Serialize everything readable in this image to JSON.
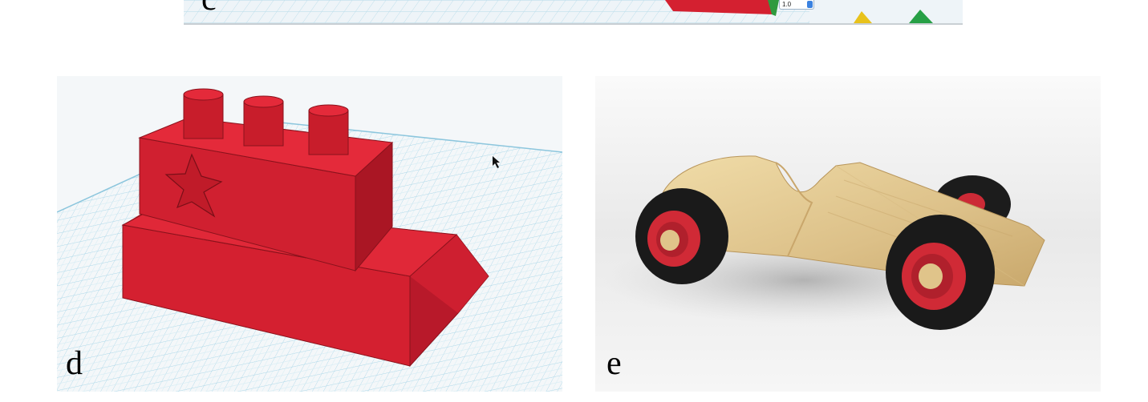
{
  "panels": {
    "c": {
      "label": "c",
      "spinner_value": "1.0"
    },
    "d": {
      "label": "d"
    },
    "e": {
      "label": "e"
    }
  },
  "colors": {
    "model_red": "#d42030",
    "grid_blue": "#9fd2e6",
    "wood": "#e0c48a",
    "tire": "#1c1c1c",
    "hub_red": "#cc2a36",
    "view_cube_yellow": "#e8c21c",
    "view_cube_green": "#27a046"
  }
}
